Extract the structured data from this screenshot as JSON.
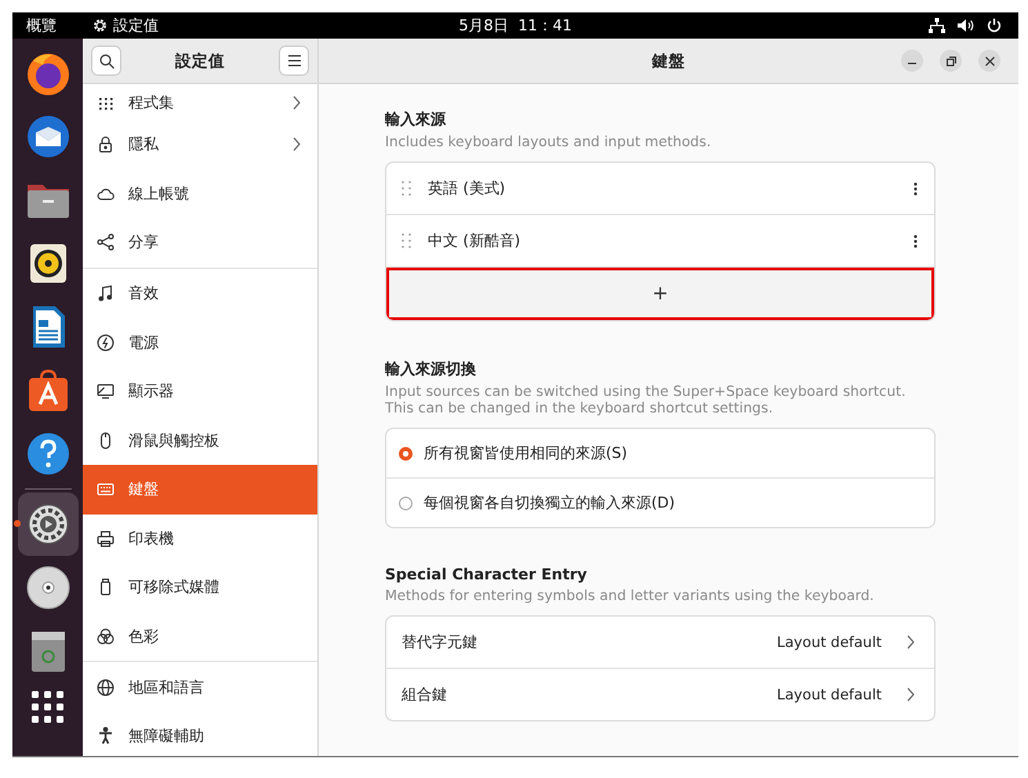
{
  "top_bar": {
    "activities": "概覽",
    "app_name": "設定值",
    "clock": "5月8日  11：41"
  },
  "dock": [
    {
      "kind": "firefox",
      "active": false
    },
    {
      "kind": "mail",
      "active": false
    },
    {
      "kind": "files",
      "active": false
    },
    {
      "kind": "speaker",
      "active": false
    },
    {
      "kind": "writer",
      "active": false
    },
    {
      "kind": "store",
      "active": false
    },
    {
      "kind": "help",
      "active": false
    },
    {
      "kind": "settings",
      "active": true
    },
    {
      "kind": "disc",
      "active": false
    },
    {
      "kind": "trash",
      "active": false
    },
    {
      "kind": "grid",
      "active": false
    }
  ],
  "sidebar": {
    "title": "設定值",
    "groups": [
      [
        {
          "label": "程式集",
          "kind": "apps",
          "has_submenu": true,
          "selected": false
        },
        {
          "label": "隱私",
          "kind": "lock",
          "has_submenu": true,
          "selected": false
        },
        {
          "label": "線上帳號",
          "kind": "cloud",
          "has_submenu": false,
          "selected": false
        },
        {
          "label": "分享",
          "kind": "share",
          "has_submenu": false,
          "selected": false
        }
      ],
      [
        {
          "label": "音效",
          "kind": "music",
          "has_submenu": false,
          "selected": false
        },
        {
          "label": "電源",
          "kind": "power",
          "has_submenu": false,
          "selected": false
        },
        {
          "label": "顯示器",
          "kind": "display",
          "has_submenu": false,
          "selected": false
        },
        {
          "label": "滑鼠與觸控板",
          "kind": "mouse",
          "has_submenu": false,
          "selected": false
        },
        {
          "label": "鍵盤",
          "kind": "keyboard",
          "has_submenu": false,
          "selected": true
        },
        {
          "label": "印表機",
          "kind": "printer",
          "has_submenu": false,
          "selected": false
        },
        {
          "label": "可移除式媒體",
          "kind": "media",
          "has_submenu": false,
          "selected": false
        },
        {
          "label": "色彩",
          "kind": "color",
          "has_submenu": false,
          "selected": false
        }
      ],
      [
        {
          "label": "地區和語言",
          "kind": "globe",
          "has_submenu": false,
          "selected": false
        },
        {
          "label": "無障礙輔助",
          "kind": "person",
          "has_submenu": false,
          "selected": false
        }
      ]
    ]
  },
  "header": {
    "title": "鍵盤"
  },
  "sections": [
    {
      "kind": "sources",
      "title": "輸入來源",
      "description_lines": [
        "Includes keyboard layouts and input methods."
      ],
      "rows": [
        {
          "label": "英語 (美式)"
        },
        {
          "label": "中文 (新酷音)"
        }
      ],
      "add_button": {
        "label": "+",
        "highlighted": true
      }
    },
    {
      "kind": "radios",
      "title": "輸入來源切換",
      "description_lines": [
        "Input sources can be switched using the Super+Space keyboard shortcut.",
        "This can be changed in the keyboard shortcut settings."
      ],
      "options": [
        {
          "label": "所有視窗皆使用相同的來源(S)",
          "selected": true
        },
        {
          "label": "每個視窗各自切換獨立的輸入來源(D)",
          "selected": false
        }
      ]
    },
    {
      "kind": "links",
      "title": "Special Character Entry",
      "description_lines": [
        "Methods for entering symbols and letter variants using the keyboard."
      ],
      "rows": [
        {
          "label": "替代字元鍵",
          "value": "Layout default"
        },
        {
          "label": "組合鍵",
          "value": "Layout default"
        }
      ]
    }
  ]
}
